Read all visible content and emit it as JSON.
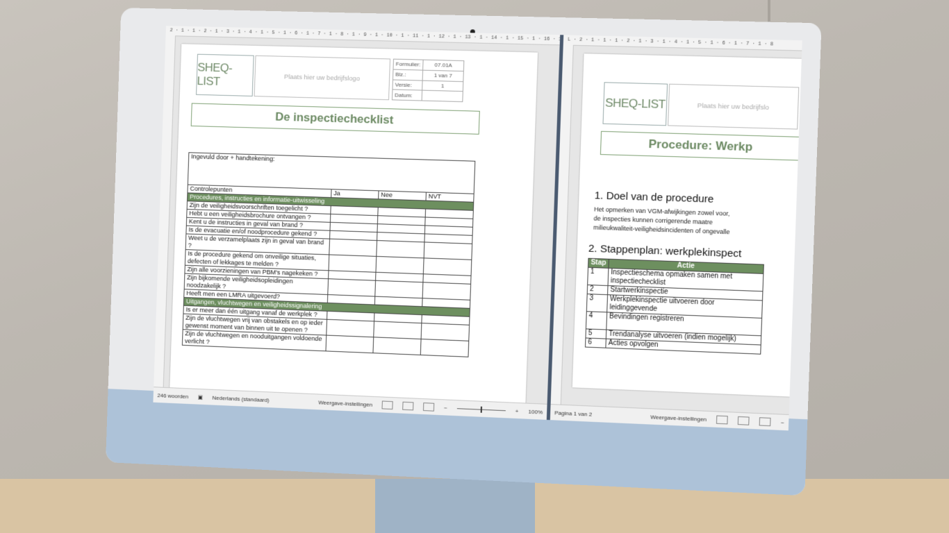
{
  "left_window": {
    "ruler": "2 · 1 · 1 · 2 · 1 · 3 · 1 · 4 · 1 · 5 · 1 · 6 · 1 · 7 · 1 · 8 · 1 · 9 · 1 · 10 · 1 · 11 · 1 · 12 · 1 · 13 · 1 · 14 · 1 · 15 · 1 · 16 · 17 · 18",
    "header": {
      "logo_text": "SHEQ-LIST",
      "company_placeholder": "Plaats hier uw bedrijfslogo",
      "meta": [
        {
          "label": "Formulier:",
          "value": "07.01A"
        },
        {
          "label": "Blz.:",
          "value": "1 van 7"
        },
        {
          "label": "Versie:",
          "value": "1"
        },
        {
          "label": "Datum:",
          "value": ""
        }
      ]
    },
    "title": "De inspectiechecklist",
    "checklist": {
      "filled_by": "Ingevuld door + handtekening:",
      "col_points": "Controlepunten",
      "col_yes": "Ja",
      "col_no": "Nee",
      "col_na": "NVT",
      "section1": "Procedures, instructies en informatie-uitwisseling",
      "rows1": [
        "Zijn de veiligheidsvoorschriften toegelicht ?",
        "Hebt u een veiligheidsbrochure ontvangen ?",
        "Kent u de instructies in geval van brand ?",
        "Is de evacuatie en/of noodprocedure gekend ?",
        "Weet u de verzamelplaats zijn in geval van brand ?",
        "Is de procedure gekend om onveilige situaties, defecten of lekkages te melden ?",
        "Zijn alle voorzieningen van PBM's nagekeken ?",
        "Zijn bijkomende veiligheidsopleidingen noodzakelijk ?",
        "Heeft men een LMRA uitgevoerd?"
      ],
      "section2": "Uitgangen, vluchtwegen en veiligheidssignalering",
      "rows2": [
        "Is er meer dan één uitgang vanaf de werkplek ?",
        "Zijn de vluchtwegen vrij van obstakels en op ieder gewenst moment van binnen uit te openen ?",
        "Zijn de vluchtwegen en nooduitgangen voldoende verlicht ?"
      ]
    },
    "status": {
      "words": "246 woorden",
      "language": "Nederlands (standaard)",
      "display_settings": "Weergave-instellingen",
      "zoom": "100%"
    }
  },
  "right_window": {
    "ruler": "L · 2 · 1 · 1 · 1 · 2 · 1 · 3 · 1 · 4 · 1 · 5 · 1 · 6 · 1 · 7 · 1 · 8",
    "header": {
      "logo_text": "SHEQ-LIST",
      "company_placeholder": "Plaats hier uw bedrijfslo"
    },
    "title": "Procedure: Werkp",
    "heading1": "1. Doel van de procedure",
    "para1": [
      "Het opmerken van VGM-afwijkingen zowel voor,",
      "de inspecties kunnen corrigerende maatre",
      "milieukwaliteit-veiligheidsincidenten of ongevalle"
    ],
    "heading2": "2. Stappenplan: werkplekinspect",
    "steps": {
      "col_step": "Stap",
      "col_action": "Actie",
      "rows": [
        {
          "n": "1",
          "action": "Inspectieschema opmaken samen met inspectiechecklist"
        },
        {
          "n": "2",
          "action": "Startwerkinspectie"
        },
        {
          "n": "3",
          "action": "Werkplekinspectie uitvoeren door leidinggevende"
        },
        {
          "n": "4",
          "action": "Bevindingen registreren"
        },
        {
          "n": "5",
          "action": "Trendanalyse uitvoeren (indien mogelijk)"
        },
        {
          "n": "6",
          "action": "Acties opvolgen"
        }
      ]
    },
    "status": {
      "page": "Pagina 1 van 2",
      "display_settings": "Weergave-instellingen"
    }
  },
  "colors": {
    "accent_green": "#6d8f5f",
    "title_green": "#6c8a63",
    "monitor_chin": "#adc2d8"
  }
}
